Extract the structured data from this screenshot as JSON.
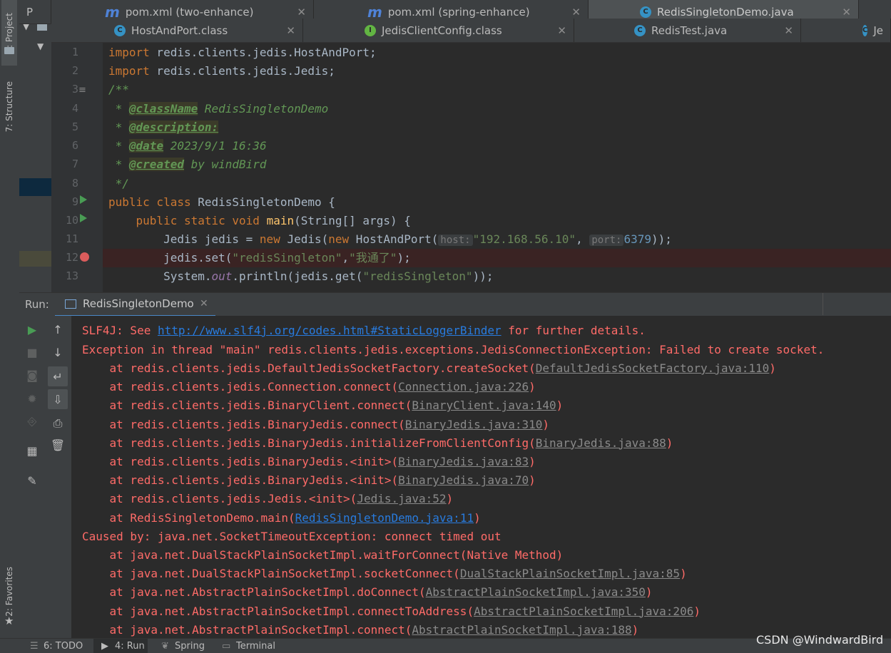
{
  "left_strip": {
    "project_tab": "1: Project",
    "structure_tab": "7: Structure",
    "favorites_tab": "2: Favorites"
  },
  "top_tabs": [
    {
      "label": "P"
    },
    {
      "label": "pom.xml (two-enhance)"
    },
    {
      "label": "pom.xml (spring-enhance)"
    },
    {
      "label": "RedisSingletonDemo.java"
    }
  ],
  "second_tabs": [
    {
      "label": "HostAndPort.class"
    },
    {
      "label": "JedisClientConfig.class"
    },
    {
      "label": "RedisTest.java"
    },
    {
      "label": "Je"
    }
  ],
  "editor": {
    "line_numbers": [
      "1",
      "2",
      "3",
      "4",
      "5",
      "6",
      "7",
      "8",
      "9",
      "10",
      "11",
      "12",
      "13"
    ],
    "line1": {
      "kw": "import",
      "rest": " redis.clients.jedis.HostAndPort;"
    },
    "line2": {
      "kw": "import",
      "rest": " redis.clients.jedis.Jedis;"
    },
    "line3": "/**",
    "line4": {
      "prefix": " * ",
      "tag": "@className",
      "rest": " RedisSingletonDemo"
    },
    "line5": {
      "prefix": " * ",
      "tag": "@description:"
    },
    "line6": {
      "prefix": " * ",
      "tag": "@date",
      "rest": " 2023/9/1 16:36"
    },
    "line7": {
      "prefix": " * ",
      "tag": "@created",
      "rest": " by windBird"
    },
    "line8": " */",
    "line9": {
      "kw": "public class",
      "rest": " RedisSingletonDemo {"
    },
    "line10": {
      "indent": "    ",
      "kw": "public static void",
      "fn": "main",
      "rest": "(String[] args) {"
    },
    "line11": {
      "indent": "        ",
      "a": "Jedis jedis = ",
      "kw1": "new",
      "b": " Jedis(",
      "kw2": "new",
      "c": " HostAndPort(",
      "hint1": "host:",
      "s1": "\"192.168.56.10\"",
      "d": ", ",
      "hint2": "port:",
      "n1": "6379",
      "e": "));"
    },
    "line12": {
      "indent": "        ",
      "a": "jedis.set(",
      "s1": "\"redisSingleton\"",
      "b": ",",
      "s2": "\"我通了\"",
      "c": ");"
    },
    "line13": {
      "indent": "        ",
      "a": "System.",
      "st": "out",
      "b": ".println(jedis.get(",
      "s1": "\"redisSingleton\"",
      "c": "));"
    }
  },
  "run_panel": {
    "label": "Run:",
    "tab_label": "RedisSingletonDemo"
  },
  "console": {
    "slf4j": {
      "text": "SLF4J: See ",
      "link": "http://www.slf4j.org/codes.html#StaticLoggerBinder",
      "tail": " for further details."
    },
    "exception": "Exception in thread \"main\" redis.clients.jedis.exceptions.JedisConnectionException: Failed to create socket.",
    "frames": [
      {
        "text": "    at redis.clients.jedis.DefaultJedisSocketFactory.createSocket(",
        "link": "DefaultJedisSocketFactory.java:110",
        "tail": ")"
      },
      {
        "text": "    at redis.clients.jedis.Connection.connect(",
        "link": "Connection.java:226",
        "tail": ")"
      },
      {
        "text": "    at redis.clients.jedis.BinaryClient.connect(",
        "link": "BinaryClient.java:140",
        "tail": ")"
      },
      {
        "text": "    at redis.clients.jedis.BinaryJedis.connect(",
        "link": "BinaryJedis.java:310",
        "tail": ")"
      },
      {
        "text": "    at redis.clients.jedis.BinaryJedis.initializeFromClientConfig(",
        "link": "BinaryJedis.java:88",
        "tail": ")"
      },
      {
        "text": "    at redis.clients.jedis.BinaryJedis.<init>(",
        "link": "BinaryJedis.java:83",
        "tail": ")"
      },
      {
        "text": "    at redis.clients.jedis.BinaryJedis.<init>(",
        "link": "BinaryJedis.java:70",
        "tail": ")"
      },
      {
        "text": "    at redis.clients.jedis.Jedis.<init>(",
        "link": "Jedis.java:52",
        "tail": ")"
      },
      {
        "text": "    at RedisSingletonDemo.main(",
        "link": "RedisSingletonDemo.java:11",
        "tail": ")"
      }
    ],
    "caused_by": "Caused by: java.net.SocketTimeoutException: connect timed out",
    "cause_frames": [
      {
        "text": "    at java.net.DualStackPlainSocketImpl.waitForConnect(Native Method)",
        "link": "",
        "tail": ""
      },
      {
        "text": "    at java.net.DualStackPlainSocketImpl.socketConnect(",
        "link": "DualStackPlainSocketImpl.java:85",
        "tail": ")"
      },
      {
        "text": "    at java.net.AbstractPlainSocketImpl.doConnect(",
        "link": "AbstractPlainSocketImpl.java:350",
        "tail": ")"
      },
      {
        "text": "    at java.net.AbstractPlainSocketImpl.connectToAddress(",
        "link": "AbstractPlainSocketImpl.java:206",
        "tail": ")"
      },
      {
        "text": "    at java.net.AbstractPlainSocketImpl.connect(",
        "link": "AbstractPlainSocketImpl.java:188",
        "tail": ")"
      }
    ]
  },
  "status_bar": {
    "todo": "6: TODO",
    "run": "4: Run",
    "spring": "Spring",
    "terminal": "Terminal"
  },
  "watermark": "CSDN @WindwardBird",
  "colors": {
    "error": "#ff6b68",
    "link": "#287bde",
    "keyword": "#cc7832",
    "string": "#6a8759",
    "accent_green": "#499c54"
  }
}
